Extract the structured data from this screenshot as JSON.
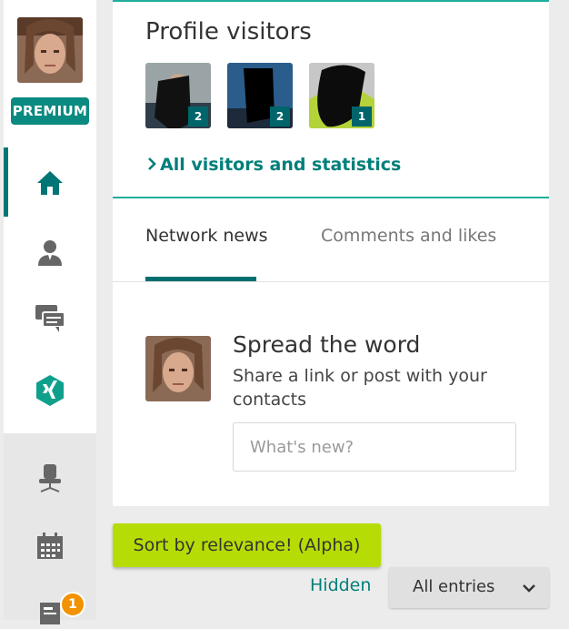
{
  "colors": {
    "brand_teal": "#007575",
    "accent_line": "#1fae9e",
    "premium_bg": "#0a8a80",
    "sort_button_bg": "#b6dc05",
    "notification": "#f39200"
  },
  "sidebar": {
    "user_avatar_alt": "",
    "premium_label": "PREMIUM",
    "items": [
      {
        "icon": "home-icon",
        "active": true
      },
      {
        "icon": "contacts-icon",
        "active": false
      },
      {
        "icon": "messages-icon",
        "active": false
      },
      {
        "icon": "xing-icon",
        "active": false
      },
      {
        "icon": "jobs-chair-icon",
        "active": false
      },
      {
        "icon": "events-calendar-icon",
        "active": false
      },
      {
        "icon": "news-icon",
        "active": false,
        "badge": "1"
      }
    ]
  },
  "profile_visitors": {
    "title": "Profile visitors",
    "visitors": [
      {
        "count": "2"
      },
      {
        "count": "2"
      },
      {
        "count": "1"
      }
    ],
    "link_label": "All visitors and statistics"
  },
  "tabs": [
    {
      "label": "Network news",
      "active": true
    },
    {
      "label": "Comments and likes",
      "active": false
    }
  ],
  "composer": {
    "title": "Spread the word",
    "subtitle": "Share a link or post with your contacts",
    "placeholder": "What's new?"
  },
  "feed_controls": {
    "sort_button_label": "Sort by relevance! (Alpha)",
    "hidden_link_label": "Hidden",
    "filter_selected": "All entries"
  }
}
